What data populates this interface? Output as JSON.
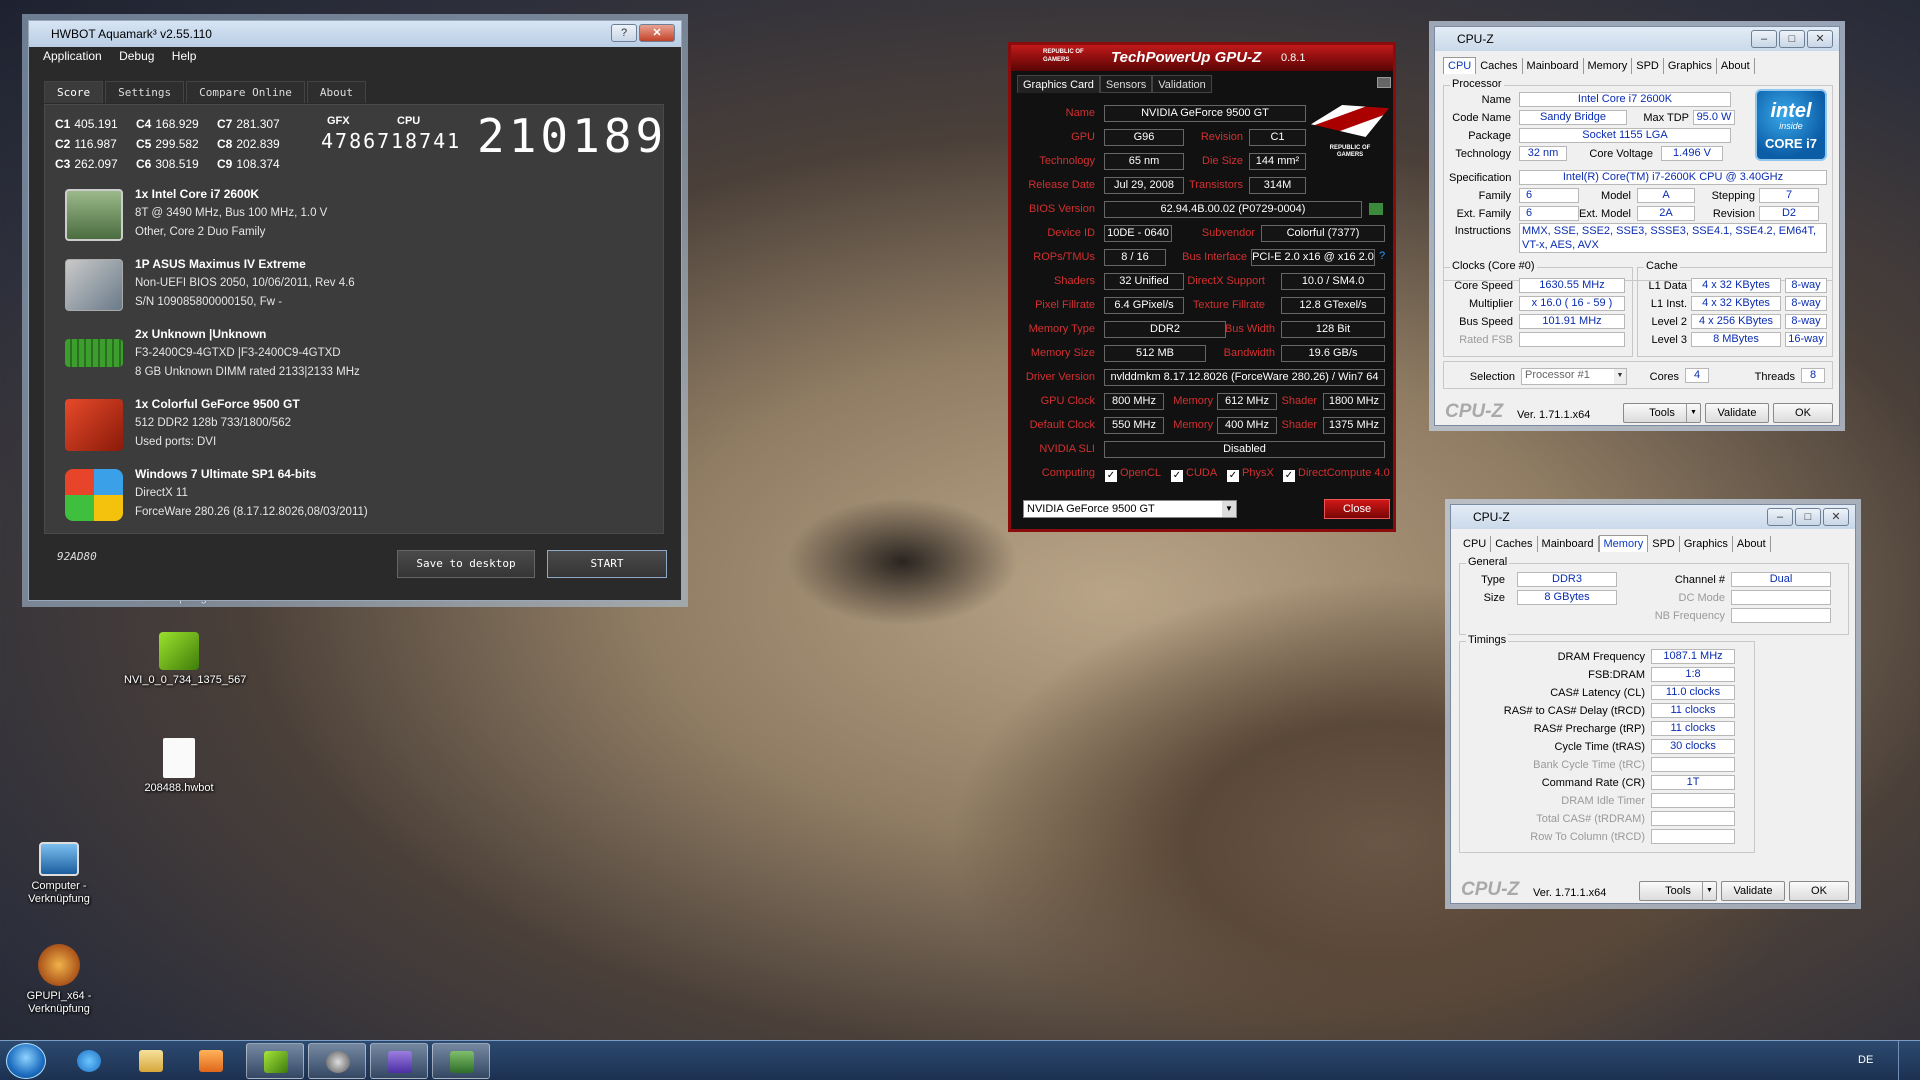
{
  "desktop": {
    "icons": [
      {
        "label": "NVI_0_0_734_1375_567"
      },
      {
        "label": "208488.hwbot"
      },
      {
        "label": "Computer - Verknüpfung"
      },
      {
        "label": "GPUPI_x64 - Verknüpfung"
      }
    ],
    "partial_label": "Verknüpfung"
  },
  "taskbar": {
    "language": "DE"
  },
  "aquamark": {
    "title": "HWBOT Aquamark³ v2.55.110",
    "menu": [
      "Application",
      "Debug",
      "Help"
    ],
    "tabs": [
      "Score",
      "Settings",
      "Compare Online",
      "About"
    ],
    "scores": [
      {
        "key": "C1",
        "value": "405.191"
      },
      {
        "key": "C4",
        "value": "168.929"
      },
      {
        "key": "C7",
        "value": "281.307"
      },
      {
        "key": "C2",
        "value": "116.987"
      },
      {
        "key": "C5",
        "value": "299.582"
      },
      {
        "key": "C8",
        "value": "202.839"
      },
      {
        "key": "C3",
        "value": "262.097"
      },
      {
        "key": "C6",
        "value": "308.519"
      },
      {
        "key": "C9",
        "value": "108.374"
      }
    ],
    "gfx_label": "GFX",
    "gfx_value": "47867",
    "cpu_label": "CPU",
    "cpu_value": "18741",
    "total_score": "210189",
    "hardware": [
      {
        "l1": "1x Intel Core i7 2600K",
        "l2": "8T @ 3490 MHz, Bus 100 MHz, 1.0 V",
        "l3": "Other, Core 2 Duo Family"
      },
      {
        "l1": "1P ASUS Maximus IV Extreme",
        "l2": "Non-UEFI BIOS 2050, 10/06/2011, Rev 4.6",
        "l3": "S/N 109085800000150, Fw -"
      },
      {
        "l1": "2x Unknown    |Unknown",
        "l2": "F3-2400C9-4GTXD   |F3-2400C9-4GTXD",
        "l3": "8 GB Unknown DIMM rated 2133|2133 MHz"
      },
      {
        "l1": "1x Colorful GeForce 9500 GT",
        "l2": "512 DDR2 128b 733/1800/562",
        "l3": "Used ports: DVI"
      },
      {
        "l1": "Windows 7 Ultimate SP1 64-bits",
        "l2": "DirectX 11",
        "l3": "ForceWare 280.26 (8.17.12.8026,08/03/2011)"
      }
    ],
    "id_code": "92AD80",
    "save_label": "Save to desktop",
    "start_label": "START"
  },
  "gpuz": {
    "brand": "REPUBLIC OF GAMERS",
    "title": "TechPowerUp GPU-Z",
    "version": "0.8.1",
    "tabs": [
      "Graphics Card",
      "Sensors",
      "Validation"
    ],
    "rog_text": "REPUBLIC OF GAMERS",
    "name_label": "Name",
    "name": "NVIDIA GeForce 9500 GT",
    "gpu_label": "GPU",
    "gpu": "G96",
    "revision_label": "Revision",
    "revision": "C1",
    "technology_label": "Technology",
    "technology": "65 nm",
    "die_label": "Die Size",
    "die": "144 mm²",
    "release_label": "Release Date",
    "release": "Jul 29, 2008",
    "transistors_label": "Transistors",
    "transistors": "314M",
    "bios_label": "BIOS Version",
    "bios": "62.94.4B.00.02 (P0729-0004)",
    "device_label": "Device ID",
    "device": "10DE - 0640",
    "subvendor_label": "Subvendor",
    "subvendor": "Colorful (7377)",
    "rops_label": "ROPs/TMUs",
    "rops": "8 / 16",
    "bus_label": "Bus Interface",
    "bus": "PCI-E 2.0 x16 @ x16 2.0",
    "shaders_label": "Shaders",
    "shaders": "32 Unified",
    "dx_label": "DirectX Support",
    "dx": "10.0 / SM4.0",
    "pixel_label": "Pixel Fillrate",
    "pixel": "6.4 GPixel/s",
    "texture_label": "Texture Fillrate",
    "texture": "12.8 GTexel/s",
    "memtype_label": "Memory Type",
    "memtype": "DDR2",
    "buswidth_label": "Bus Width",
    "buswidth": "128 Bit",
    "memsize_label": "Memory Size",
    "memsize": "512 MB",
    "bandwidth_label": "Bandwidth",
    "bandwidth": "19.6 GB/s",
    "driver_label": "Driver Version",
    "driver": "nvlddmkm 8.17.12.8026 (ForceWare 280.26) / Win7 64",
    "gpuclock_label": "GPU Clock",
    "gpuclock": "800 MHz",
    "memory_label": "Memory",
    "memclock": "612 MHz",
    "shader_label": "Shader",
    "shaderclock": "1800 MHz",
    "defclock_label": "Default Clock",
    "defclock": "550 MHz",
    "defmem": "400 MHz",
    "defshader": "1375 MHz",
    "sli_label": "NVIDIA SLI",
    "sli": "Disabled",
    "computing_label": "Computing",
    "computing": [
      "OpenCL",
      "CUDA",
      "PhysX",
      "DirectCompute 4.0"
    ],
    "check_mark": "✓",
    "dropdown": "NVIDIA GeForce 9500 GT",
    "close_label": "Close"
  },
  "cpuz1": {
    "title": "CPU-Z",
    "tabs": [
      "CPU",
      "Caches",
      "Mainboard",
      "Memory",
      "SPD",
      "Graphics",
      "About"
    ],
    "processor_group": "Processor",
    "name_label": "Name",
    "name": "Intel Core i7 2600K",
    "codename_label": "Code Name",
    "codename": "Sandy Bridge",
    "tdp_label": "Max TDP",
    "tdp": "95.0 W",
    "package_label": "Package",
    "package": "Socket 1155 LGA",
    "tech_label": "Technology",
    "tech": "32 nm",
    "voltage_label": "Core Voltage",
    "voltage": "1.496 V",
    "spec_label": "Specification",
    "spec": "Intel(R) Core(TM) i7-2600K CPU @ 3.40GHz",
    "family_label": "Family",
    "family": "6",
    "model_label": "Model",
    "model": "A",
    "stepping_label": "Stepping",
    "stepping": "7",
    "extfamily_label": "Ext. Family",
    "extfamily": "6",
    "extmodel_label": "Ext. Model",
    "extmodel": "2A",
    "revision_label": "Revision",
    "revision": "D2",
    "instr_label": "Instructions",
    "instr1": "MMX, SSE, SSE2, SSE3, SSSE3, SSE4.1, SSE4.2, EM64T,",
    "instr2": "VT-x, AES, AVX",
    "intel_logo": "intel",
    "intel_inside": "inside",
    "intel_core": "CORE i7",
    "clocks_group": "Clocks (Core #0)",
    "corespeed_label": "Core Speed",
    "corespeed": "1630.55 MHz",
    "multiplier_label": "Multiplier",
    "multiplier": "x 16.0 ( 16 - 59 )",
    "busspeed_label": "Bus Speed",
    "busspeed": "101.91 MHz",
    "ratedfsb_label": "Rated FSB",
    "cache_group": "Cache",
    "l1d_label": "L1 Data",
    "l1d": "4 x 32 KBytes",
    "l1d_way": "8-way",
    "l1i_label": "L1 Inst.",
    "l1i": "4 x 32 KBytes",
    "l1i_way": "8-way",
    "l2_label": "Level 2",
    "l2": "4 x 256 KBytes",
    "l2_way": "8-way",
    "l3_label": "Level 3",
    "l3": "8 MBytes",
    "l3_way": "16-way",
    "selection_label": "Selection",
    "selection": "Processor #1",
    "cores_label": "Cores",
    "cores": "4",
    "threads_label": "Threads",
    "threads": "8",
    "logo": "CPU-Z",
    "version": "Ver. 1.71.1.x64",
    "tools_label": "Tools",
    "validate_label": "Validate",
    "ok_label": "OK"
  },
  "cpuz2": {
    "title": "CPU-Z",
    "tabs": [
      "CPU",
      "Caches",
      "Mainboard",
      "Memory",
      "SPD",
      "Graphics",
      "About"
    ],
    "general_group": "General",
    "type_label": "Type",
    "type": "DDR3",
    "channel_label": "Channel #",
    "channel": "Dual",
    "size_label": "Size",
    "size": "8 GBytes",
    "dcmode_label": "DC Mode",
    "nbfreq_label": "NB Frequency",
    "timings_group": "Timings",
    "timings": [
      {
        "label": "DRAM Frequency",
        "value": "1087.1 MHz",
        "gray": false
      },
      {
        "label": "FSB:DRAM",
        "value": "1:8",
        "gray": false
      },
      {
        "label": "CAS# Latency (CL)",
        "value": "11.0 clocks",
        "gray": false
      },
      {
        "label": "RAS# to CAS# Delay (tRCD)",
        "value": "11 clocks",
        "gray": false
      },
      {
        "label": "RAS# Precharge (tRP)",
        "value": "11 clocks",
        "gray": false
      },
      {
        "label": "Cycle Time (tRAS)",
        "value": "30 clocks",
        "gray": false
      },
      {
        "label": "Bank Cycle Time (tRC)",
        "value": "",
        "gray": true
      },
      {
        "label": "Command Rate (CR)",
        "value": "1T",
        "gray": false
      },
      {
        "label": "DRAM Idle Timer",
        "value": "",
        "gray": true
      },
      {
        "label": "Total CAS# (tRDRAM)",
        "value": "",
        "gray": true
      },
      {
        "label": "Row To Column (tRCD)",
        "value": "",
        "gray": true
      }
    ],
    "logo": "CPU-Z",
    "version": "Ver. 1.71.1.x64",
    "tools_label": "Tools",
    "validate_label": "Validate",
    "ok_label": "OK"
  }
}
